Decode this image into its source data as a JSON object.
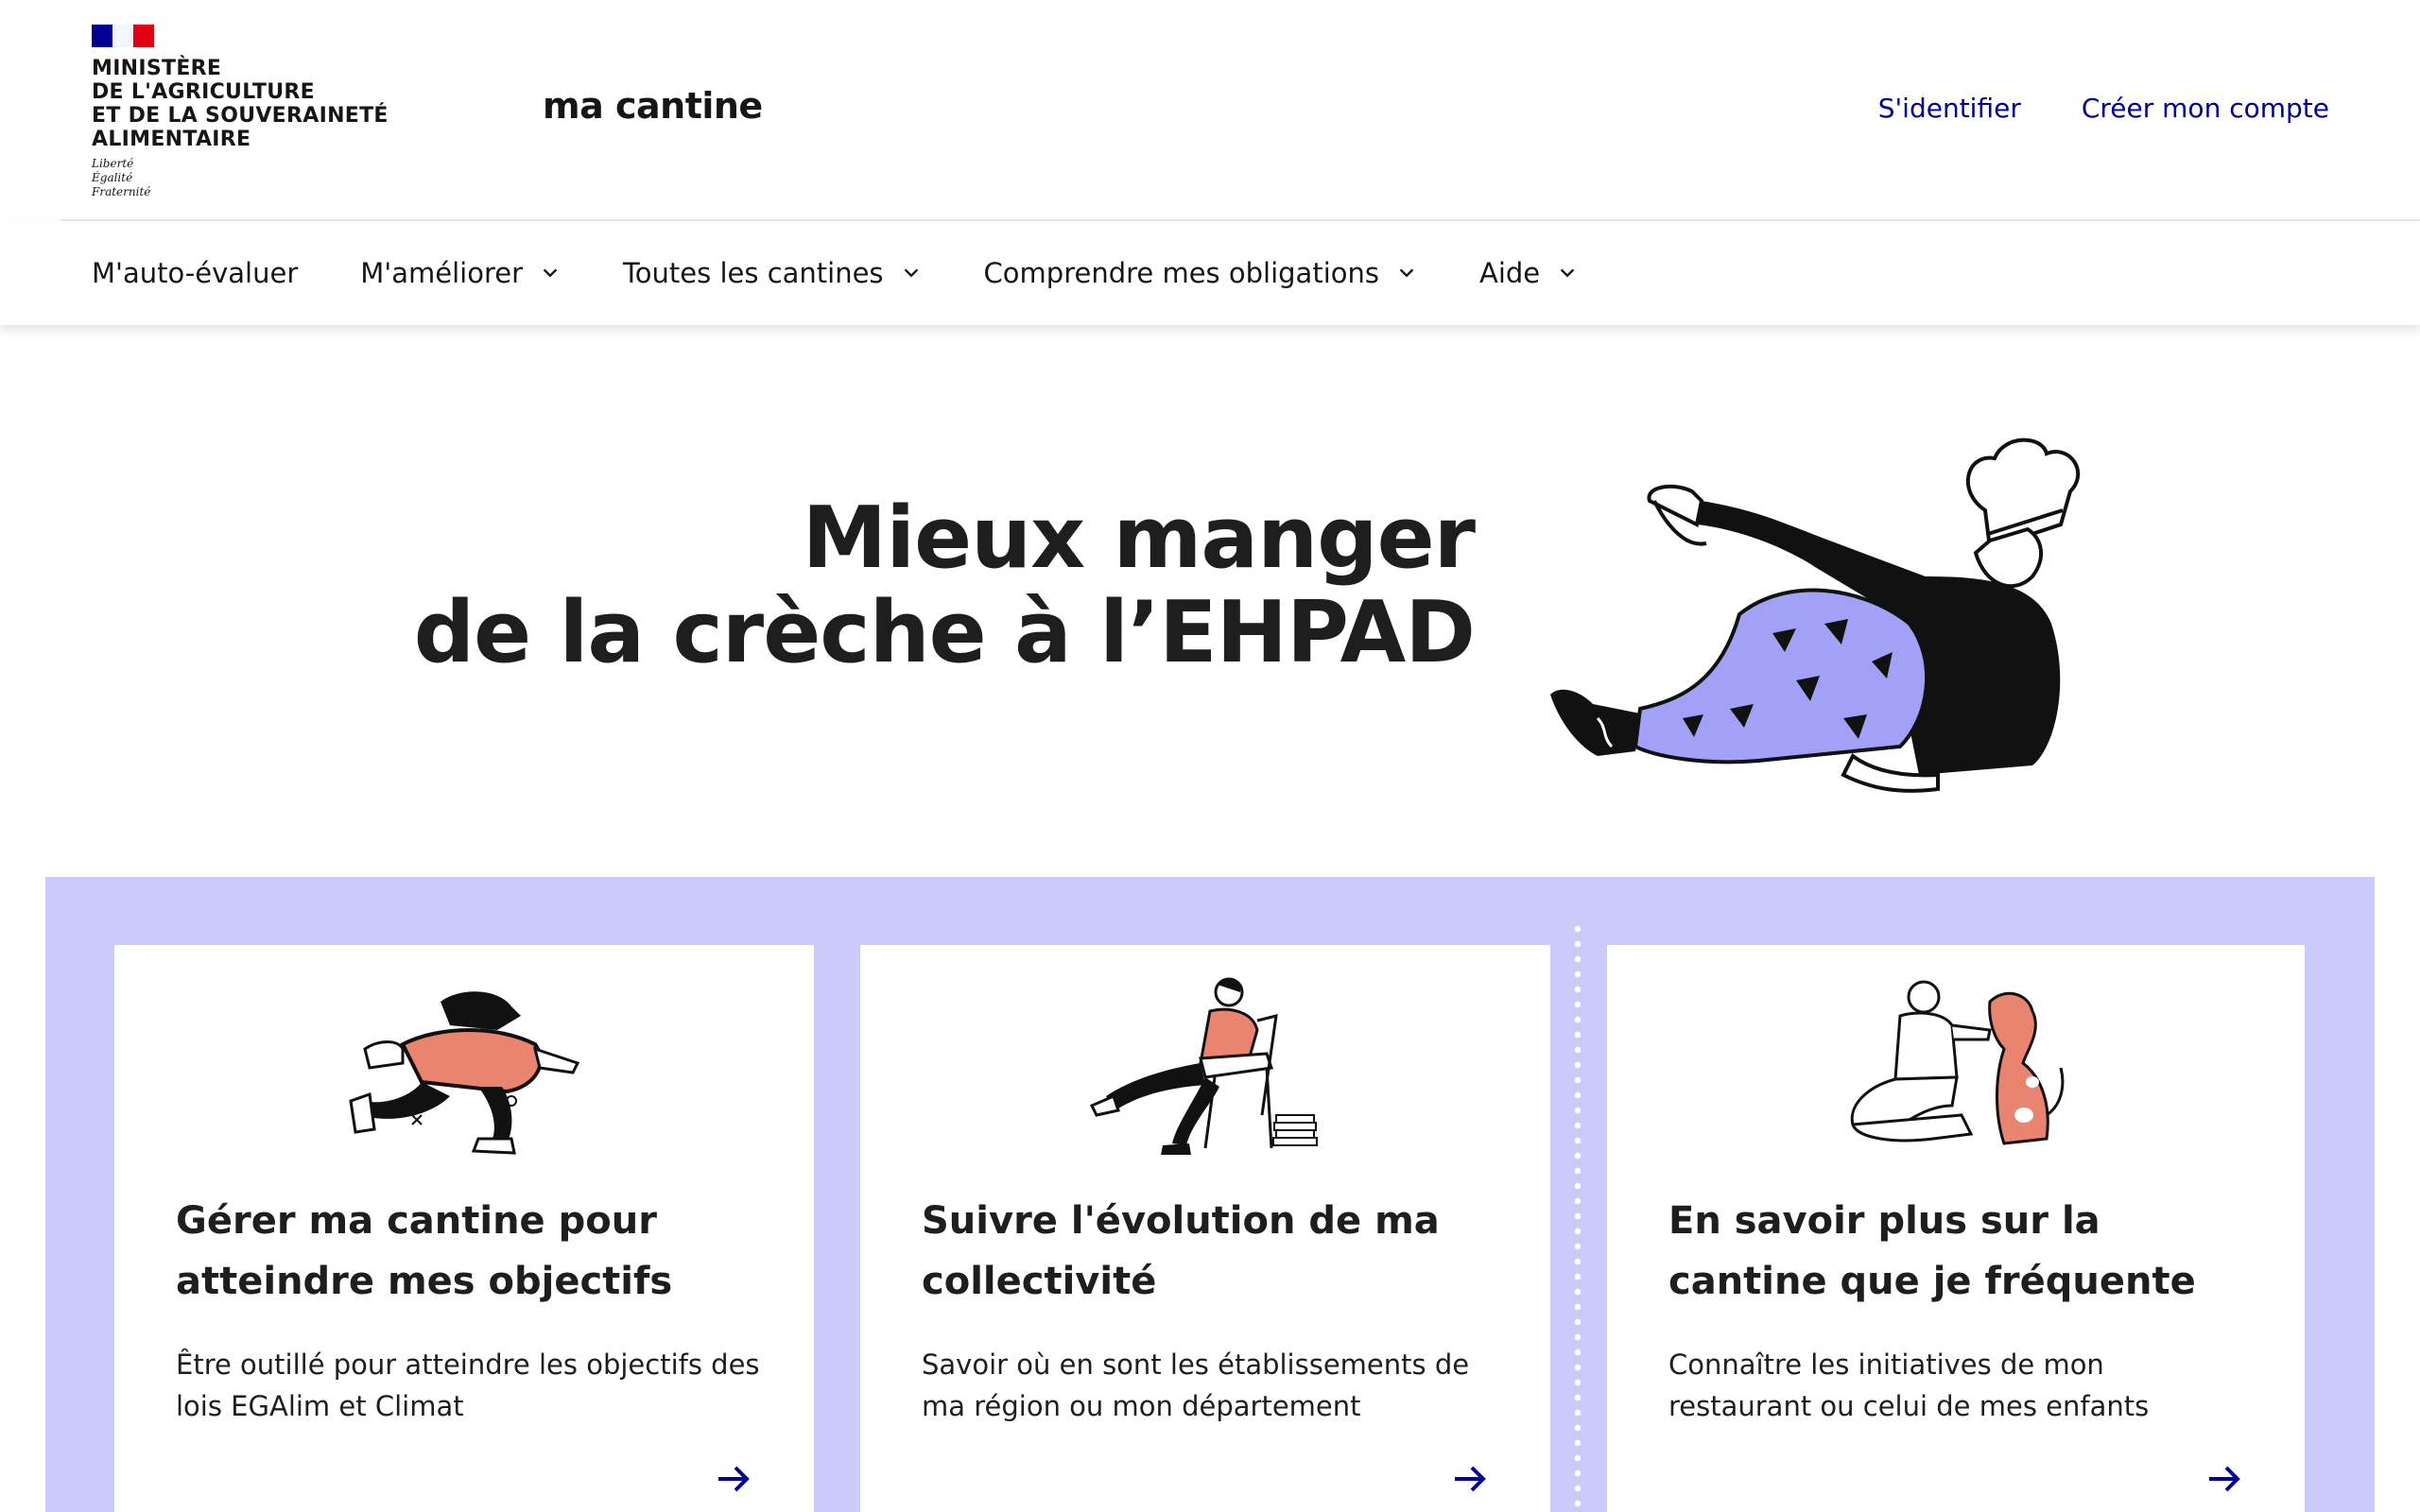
{
  "header": {
    "ministry_lines": [
      "MINISTÈRE",
      "DE L'AGRICULTURE",
      "ET DE LA SOUVERAINETÉ",
      "ALIMENTAIRE"
    ],
    "motto_lines": [
      "Liberté",
      "Égalité",
      "Fraternité"
    ],
    "site_name": "ma cantine",
    "login_label": "S'identifier",
    "signup_label": "Créer mon compte"
  },
  "nav": {
    "items": [
      {
        "label": "M'auto-évaluer",
        "has_dropdown": false
      },
      {
        "label": "M'améliorer",
        "has_dropdown": true
      },
      {
        "label": "Toutes les cantines",
        "has_dropdown": true
      },
      {
        "label": "Comprendre mes obligations",
        "has_dropdown": true
      },
      {
        "label": "Aide",
        "has_dropdown": true
      }
    ]
  },
  "hero": {
    "title_line1": "Mieux manger",
    "title_line2": "de la crèche à l’EHPAD"
  },
  "cards": [
    {
      "title": "Gérer ma cantine pour atteindre mes objectifs",
      "description": "Être outillé pour atteindre les objectifs des lois EGAlim et Climat",
      "icon": "arrow-right-icon"
    },
    {
      "title": "Suivre l'évolution de ma collectivité",
      "description": "Savoir où en sont les établissements de ma région ou mon département",
      "icon": "arrow-right-icon"
    },
    {
      "title": "En savoir plus sur la cantine que je fréquente",
      "description": "Connaître les initiatives de mon restaurant ou celui de mes enfants",
      "icon": "arrow-right-icon"
    }
  ],
  "colors": {
    "brand_blue": "#000091",
    "cards_background": "#cacafb",
    "illustration_purple": "#a3a1f7",
    "illustration_salmon": "#e8846f",
    "text": "#1e1e1e"
  }
}
